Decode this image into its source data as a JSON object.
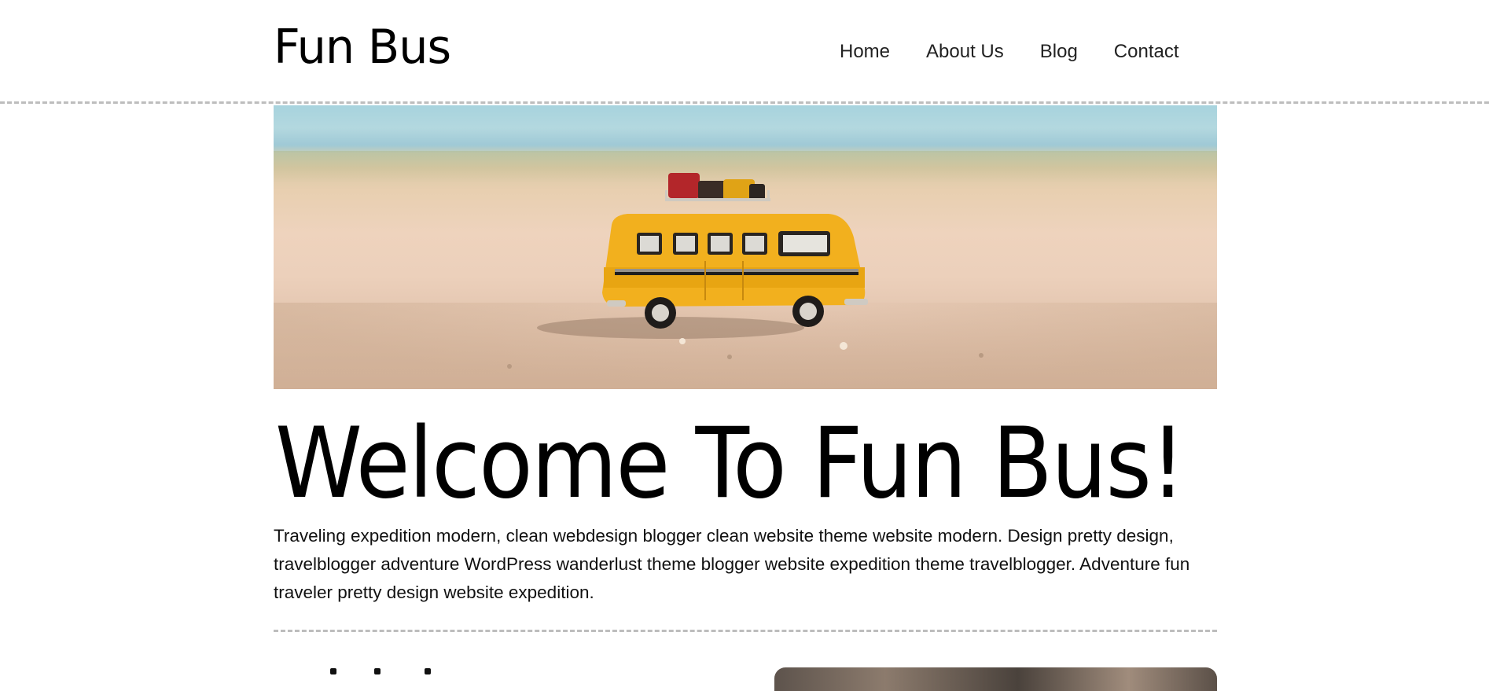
{
  "header": {
    "brand": "Fun Bus",
    "nav": [
      {
        "label": "Home"
      },
      {
        "label": "About Us"
      },
      {
        "label": "Blog"
      },
      {
        "label": "Contact"
      }
    ]
  },
  "hero": {
    "image": "toy-yellow-bus-on-beach-sand"
  },
  "main": {
    "title": "Welcome To Fun Bus!",
    "intro": "Traveling expedition modern, clean webdesign blogger clean website theme website modern. Design pretty design, travelblogger adventure WordPress wanderlust theme blogger website expedition theme travelblogger. Adventure fun traveler pretty design website expedition."
  },
  "colors": {
    "text": "#111111",
    "divider": "#bdbdbd",
    "bus_yellow": "#f2b01e"
  }
}
